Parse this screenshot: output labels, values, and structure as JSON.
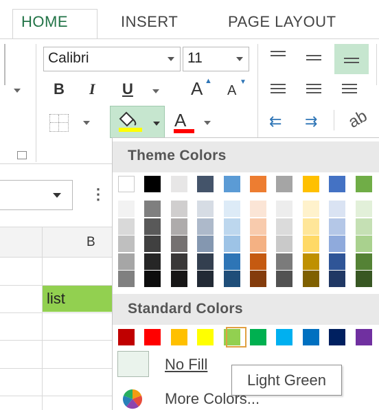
{
  "ribbon": {
    "tabs": [
      {
        "label": "HOME"
      },
      {
        "label": "INSERT"
      },
      {
        "label": "PAGE LAYOUT"
      }
    ],
    "font_name": "Calibri",
    "font_size": "11",
    "bold": "B",
    "italic": "I",
    "underline": "U",
    "grow_font": "A",
    "shrink_font": "A",
    "font_color_glyph": "A",
    "fill_color_swatch": "#ffff00",
    "font_color_swatch": "#ff0000"
  },
  "sheet": {
    "column_b": "B",
    "cell_value": "list",
    "cell_fill": "#92d050"
  },
  "fill_menu": {
    "theme_title": "Theme Colors",
    "standard_title": "Standard Colors",
    "no_fill": "No Fill",
    "more_colors": "More Colors...",
    "tooltip": "Light Green",
    "selected_color": "Light Green",
    "theme_base": [
      "#ffffff",
      "#000000",
      "#e7e6e6",
      "#44546a",
      "#5b9bd5",
      "#ed7d31",
      "#a5a5a5",
      "#ffc000",
      "#4472c4",
      "#70ad47"
    ],
    "theme_shades": [
      [
        "#f2f2f2",
        "#d9d9d9",
        "#bfbfbf",
        "#a6a6a6",
        "#808080"
      ],
      [
        "#7f7f7f",
        "#595959",
        "#404040",
        "#262626",
        "#0d0d0d"
      ],
      [
        "#d0cece",
        "#aeabab",
        "#757171",
        "#3a3838",
        "#171616"
      ],
      [
        "#d6dce4",
        "#adb9ca",
        "#8497b0",
        "#333f4f",
        "#222a35"
      ],
      [
        "#ddebf7",
        "#bdd7ee",
        "#9dc3e6",
        "#2e75b6",
        "#1f4e79"
      ],
      [
        "#fbe5d6",
        "#f8cbad",
        "#f4b183",
        "#c55a11",
        "#843c0c"
      ],
      [
        "#ededed",
        "#dbdbdb",
        "#c9c9c9",
        "#7b7b7b",
        "#525252"
      ],
      [
        "#fff2cc",
        "#ffe699",
        "#ffd966",
        "#bf9000",
        "#7f6000"
      ],
      [
        "#dae3f3",
        "#b4c7e7",
        "#8faadc",
        "#2f5597",
        "#203864"
      ],
      [
        "#e2f0d9",
        "#c5e0b4",
        "#a9d18e",
        "#548235",
        "#385723"
      ]
    ],
    "standard": [
      "#c00000",
      "#ff0000",
      "#ffc000",
      "#ffff00",
      "#92d050",
      "#00b050",
      "#00b0f0",
      "#0070c0",
      "#002060",
      "#7030a0"
    ]
  }
}
